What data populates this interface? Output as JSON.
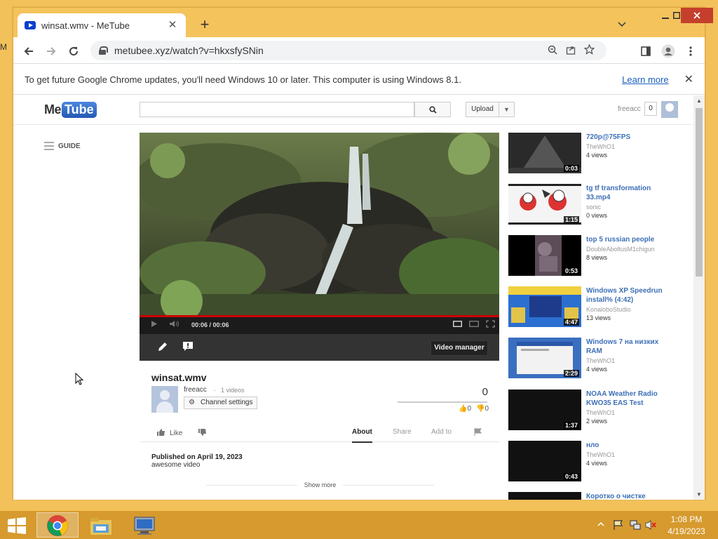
{
  "desktop": {
    "fragment": "M"
  },
  "browser": {
    "tab_title": "winsat.wmv - MeTube",
    "tab_close": "✕",
    "new_tab": "+",
    "url": "metubee.xyz/watch?v=hkxsfySNin"
  },
  "infobar": {
    "message": "To get future Google Chrome updates, you'll need Windows 10 or later. This computer is using Windows 8.1.",
    "learn_more": "Learn more",
    "close": "✕"
  },
  "metube": {
    "logo_me": "Me",
    "logo_tube": "Tube",
    "search_placeholder": "",
    "upload": "Upload",
    "username": "freeacc",
    "notifications": "0",
    "guide": "GUIDE"
  },
  "player": {
    "time": "00:06 / 00:06",
    "progress": 1.0,
    "video_manager": "Video manager"
  },
  "video": {
    "title": "winsat.wmv",
    "channel": "freeacc",
    "channel_videos": "1 videos",
    "channel_settings": "Channel settings",
    "views": "0",
    "likes": "0",
    "dislikes": "0",
    "like_label": "Like",
    "tabs": [
      "About",
      "Share",
      "Add to"
    ],
    "published": "Published on April 19, 2023",
    "description": "awesome video",
    "show_more": "Show more"
  },
  "related": [
    {
      "title": "720p@75FPS",
      "channel": "TheWhO1",
      "views": "4 views",
      "duration": "0:03"
    },
    {
      "title": "tg tf transformation 33.mp4",
      "channel": "sonic",
      "views": "0 views",
      "duration": "1:15"
    },
    {
      "title": "top 5 russian people",
      "channel": "DoubleAboltusM1chigun",
      "views": "8 views",
      "duration": "0:53"
    },
    {
      "title": "Windows XP Speedrun install% (4:42)",
      "channel": "KonaloboStudio",
      "views": "13 views",
      "duration": "4:47"
    },
    {
      "title": "Windows 7 на низких RAM",
      "channel": "TheWhO1",
      "views": "4 views",
      "duration": "2:29"
    },
    {
      "title": "NOAA Weather Radio KWO35 EAS Test",
      "channel": "TheWhO1",
      "views": "2 views",
      "duration": "1:37"
    },
    {
      "title": "нло",
      "channel": "TheWhO1",
      "views": "4 views",
      "duration": "0:43"
    },
    {
      "title": "Коротко о чистке",
      "channel": "",
      "views": "",
      "duration": ""
    }
  ],
  "taskbar": {
    "time": "1:08 PM",
    "date": "4/19/2023"
  },
  "colors": {
    "desktop": "#f2c15a",
    "taskbar": "#d69a2e",
    "link": "#3d6fb6",
    "close_button": "#c4402c"
  }
}
